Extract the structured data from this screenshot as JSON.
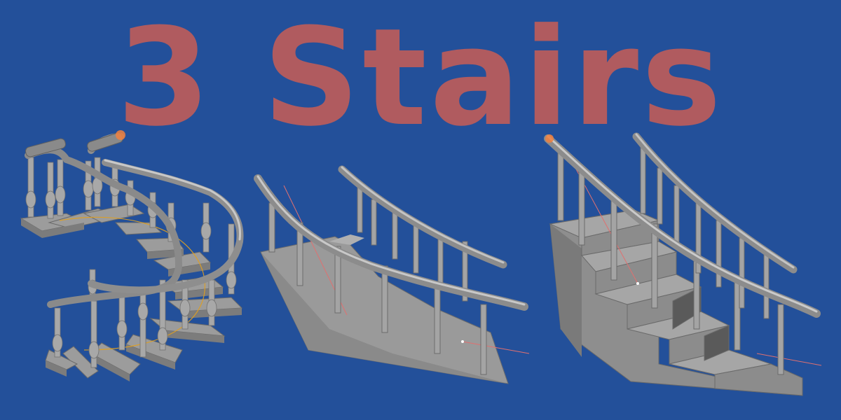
{
  "title": "3 Stairs",
  "colors": {
    "background": "#23509a",
    "title_text": "#b85c5c",
    "stair_light": "#a9a9a9",
    "stair_mid": "#8f8f8f",
    "stair_dark": "#6e6e6e",
    "rail": "#9b9b9b",
    "rail_highlight": "#c8c8c8",
    "curve_guide": "#e0a020",
    "axis_guide": "#e07070",
    "selection_glow": "#f08040"
  },
  "models": [
    {
      "name": "spiral-staircase",
      "style": "spiral with turned balusters"
    },
    {
      "name": "ramp-staircase",
      "style": "curved ramp with straight balusters"
    },
    {
      "name": "stepped-staircase",
      "style": "curved steps with straight balusters"
    }
  ]
}
